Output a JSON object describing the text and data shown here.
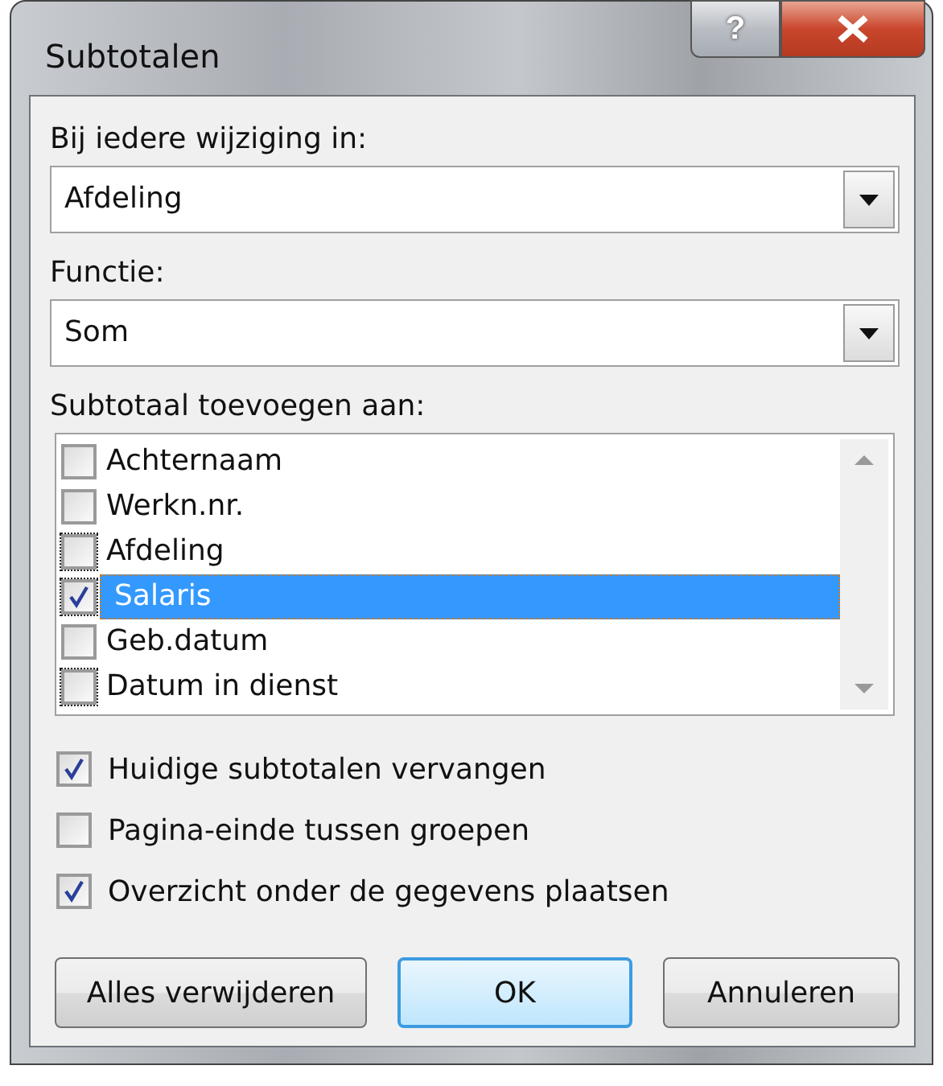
{
  "window": {
    "title": "Subtotalen",
    "help_button": "?"
  },
  "group_by": {
    "label": "Bij iedere wijziging in:",
    "value": "Afdeling"
  },
  "function": {
    "label": "Functie:",
    "value": "Som"
  },
  "add_to": {
    "label": "Subtotaal toevoegen aan:",
    "items": [
      {
        "label": "Achternaam",
        "checked": false,
        "selected": false
      },
      {
        "label": "Werkn.nr.",
        "checked": false,
        "selected": false
      },
      {
        "label": "Afdeling",
        "checked": false,
        "selected": false
      },
      {
        "label": "Salaris",
        "checked": true,
        "selected": true
      },
      {
        "label": "Geb.datum",
        "checked": false,
        "selected": false
      },
      {
        "label": "Datum in dienst",
        "checked": false,
        "selected": false
      }
    ]
  },
  "options": [
    {
      "label": "Huidige subtotalen vervangen",
      "checked": true
    },
    {
      "label": "Pagina-einde tussen groepen",
      "checked": false
    },
    {
      "label": "Overzicht onder de gegevens plaatsen",
      "checked": true
    }
  ],
  "buttons": [
    {
      "label": "Alles verwijderen",
      "default": false
    },
    {
      "label": "OK",
      "default": true
    },
    {
      "label": "Annuleren",
      "default": false
    }
  ]
}
